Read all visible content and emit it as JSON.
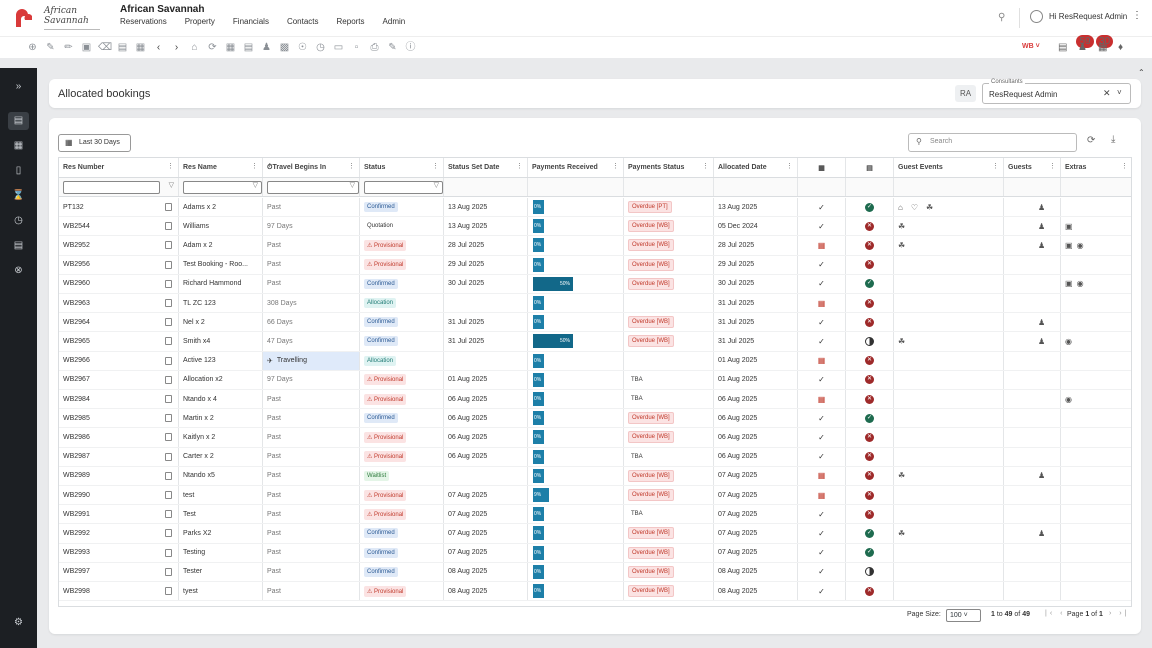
{
  "app": {
    "title": "African Savannah",
    "logo_text": "African Savannah"
  },
  "menu": [
    "Reservations",
    "Property",
    "Financials",
    "Contacts",
    "Reports",
    "Admin"
  ],
  "user": {
    "greeting": "Hi ResRequest Admin"
  },
  "toolbar": {
    "wb": "WB",
    "badge1": "59",
    "badge2": "30"
  },
  "page": {
    "title": "Allocated bookings",
    "initials": "RA",
    "consultants_label": "Consultants",
    "consultants_value": "ResRequest Admin"
  },
  "filters": {
    "date_range": "Last 30 Days",
    "search_placeholder": "Search"
  },
  "columns": [
    "Res Number",
    "Res Name",
    "Travel Begins In",
    "Status",
    "Status Set Date",
    "Payments Received",
    "Payments Status",
    "Allocated Date",
    "",
    "",
    "Guest Events",
    "Guests",
    "Extras"
  ],
  "rows": [
    {
      "res": "PT132",
      "name": "Adams x 2",
      "travel": "Past",
      "status": "Confirmed",
      "ssd": "13 Aug 2025",
      "pay": "0%",
      "ps": "Overdue [PT]",
      "alloc": "13 Aug 2025",
      "cal": "check",
      "bed": "green",
      "events": [
        "bed",
        "heart",
        "leaf"
      ],
      "guest": true,
      "extras": []
    },
    {
      "res": "WB2544",
      "name": "Williams",
      "travel": "97 Days",
      "status": "Quotation",
      "ssd": "13 Aug 2025",
      "pay": "0%",
      "ps": "Overdue [WB]",
      "alloc": "05 Dec 2024",
      "cal": "check",
      "bed": "red",
      "events": [
        "leaf"
      ],
      "guest": true,
      "extras": [
        "img"
      ]
    },
    {
      "res": "WB2952",
      "name": "Adam x 2",
      "travel": "Past",
      "status": "Provisional",
      "ssd": "28 Jul 2025",
      "pay": "0%",
      "ps": "Overdue [WB]",
      "alloc": "28 Jul 2025",
      "cal": "cal",
      "bed": "red",
      "events": [
        "leaf"
      ],
      "guest": true,
      "extras": [
        "img",
        "cam"
      ]
    },
    {
      "res": "WB2956",
      "name": "Test Booking - Roo...",
      "travel": "Past",
      "status": "Provisional",
      "ssd": "29 Jul 2025",
      "pay": "0%",
      "ps": "Overdue [WB]",
      "alloc": "29 Jul 2025",
      "cal": "check",
      "bed": "red",
      "events": [],
      "guest": false,
      "extras": []
    },
    {
      "res": "WB2960",
      "name": "Richard Hammond",
      "travel": "Past",
      "status": "Confirmed",
      "ssd": "30 Jul 2025",
      "pay": "50%",
      "ps": "Overdue [WB]",
      "alloc": "30 Jul 2025",
      "cal": "check",
      "bed": "green",
      "events": [],
      "guest": false,
      "extras": [
        "img",
        "cam"
      ]
    },
    {
      "res": "WB2963",
      "name": "TL ZC 123",
      "travel": "308 Days",
      "status": "Allocation",
      "ssd": "",
      "pay": "0%",
      "ps": "",
      "alloc": "31 Jul 2025",
      "cal": "cal",
      "bed": "red",
      "events": [],
      "guest": false,
      "extras": []
    },
    {
      "res": "WB2964",
      "name": "Nel x 2",
      "travel": "66 Days",
      "status": "Confirmed",
      "ssd": "31 Jul 2025",
      "pay": "0%",
      "ps": "Overdue [WB]",
      "alloc": "31 Jul 2025",
      "cal": "check",
      "bed": "red",
      "events": [],
      "guest": true,
      "extras": []
    },
    {
      "res": "WB2965",
      "name": "Smith x4",
      "travel": "47 Days",
      "status": "Confirmed",
      "ssd": "31 Jul 2025",
      "pay": "50%",
      "ps": "Overdue [WB]",
      "alloc": "31 Jul 2025",
      "cal": "check",
      "bed": "half",
      "events": [
        "leaf"
      ],
      "guest": true,
      "extras": [
        "cam"
      ]
    },
    {
      "res": "WB2966",
      "name": "Active 123",
      "travel": "Travelling",
      "status": "Allocation",
      "ssd": "",
      "pay": "0%",
      "ps": "",
      "alloc": "01 Aug 2025",
      "cal": "cal",
      "bed": "red",
      "events": [],
      "guest": false,
      "extras": []
    },
    {
      "res": "WB2967",
      "name": "Allocation x2",
      "travel": "97 Days",
      "status": "Provisional",
      "ssd": "01 Aug 2025",
      "pay": "0%",
      "ps": "TBA",
      "alloc": "01 Aug 2025",
      "cal": "check",
      "bed": "red",
      "events": [],
      "guest": false,
      "extras": []
    },
    {
      "res": "WB2984",
      "name": "Ntando x 4",
      "travel": "Past",
      "status": "Provisional",
      "ssd": "06 Aug 2025",
      "pay": "0%",
      "ps": "TBA",
      "alloc": "06 Aug 2025",
      "cal": "cal",
      "bed": "red",
      "events": [],
      "guest": false,
      "extras": [
        "cam"
      ]
    },
    {
      "res": "WB2985",
      "name": "Martin x 2",
      "travel": "Past",
      "status": "Confirmed",
      "ssd": "06 Aug 2025",
      "pay": "0%",
      "ps": "Overdue [WB]",
      "alloc": "06 Aug 2025",
      "cal": "check",
      "bed": "green",
      "events": [],
      "guest": false,
      "extras": []
    },
    {
      "res": "WB2986",
      "name": "Kaitlyn x 2",
      "travel": "Past",
      "status": "Provisional",
      "ssd": "06 Aug 2025",
      "pay": "0%",
      "ps": "Overdue [WB]",
      "alloc": "06 Aug 2025",
      "cal": "check",
      "bed": "red",
      "events": [],
      "guest": false,
      "extras": []
    },
    {
      "res": "WB2987",
      "name": "Carter x 2",
      "travel": "Past",
      "status": "Provisional",
      "ssd": "06 Aug 2025",
      "pay": "0%",
      "ps": "TBA",
      "alloc": "06 Aug 2025",
      "cal": "check",
      "bed": "red",
      "events": [],
      "guest": false,
      "extras": []
    },
    {
      "res": "WB2989",
      "name": "Ntando x5",
      "travel": "Past",
      "status": "Waitlist",
      "ssd": "",
      "pay": "0%",
      "ps": "Overdue [WB]",
      "alloc": "07 Aug 2025",
      "cal": "cal",
      "bed": "red",
      "events": [
        "leaf"
      ],
      "guest": true,
      "extras": []
    },
    {
      "res": "WB2990",
      "name": "test",
      "travel": "Past",
      "status": "Provisional",
      "ssd": "07 Aug 2025",
      "pay": "9%",
      "ps": "Overdue [WB]",
      "alloc": "07 Aug 2025",
      "cal": "cal",
      "bed": "red",
      "events": [],
      "guest": false,
      "extras": []
    },
    {
      "res": "WB2991",
      "name": "Test",
      "travel": "Past",
      "status": "Provisional",
      "ssd": "07 Aug 2025",
      "pay": "0%",
      "ps": "TBA",
      "alloc": "07 Aug 2025",
      "cal": "check",
      "bed": "red",
      "events": [],
      "guest": false,
      "extras": []
    },
    {
      "res": "WB2992",
      "name": "Parks X2",
      "travel": "Past",
      "status": "Confirmed",
      "ssd": "07 Aug 2025",
      "pay": "0%",
      "ps": "Overdue [WB]",
      "alloc": "07 Aug 2025",
      "cal": "check",
      "bed": "green",
      "events": [
        "leaf"
      ],
      "guest": true,
      "extras": []
    },
    {
      "res": "WB2993",
      "name": "Testing",
      "travel": "Past",
      "status": "Confirmed",
      "ssd": "07 Aug 2025",
      "pay": "0%",
      "ps": "Overdue [WB]",
      "alloc": "07 Aug 2025",
      "cal": "check",
      "bed": "green",
      "events": [],
      "guest": false,
      "extras": []
    },
    {
      "res": "WB2997",
      "name": "Tester",
      "travel": "Past",
      "status": "Confirmed",
      "ssd": "08 Aug 2025",
      "pay": "0%",
      "ps": "Overdue [WB]",
      "alloc": "08 Aug 2025",
      "cal": "check",
      "bed": "half",
      "events": [],
      "guest": false,
      "extras": []
    },
    {
      "res": "WB2998",
      "name": "tyest",
      "travel": "Past",
      "status": "Provisional",
      "ssd": "08 Aug 2025",
      "pay": "0%",
      "ps": "Overdue [WB]",
      "alloc": "08 Aug 2025",
      "cal": "check",
      "bed": "red",
      "events": [],
      "guest": false,
      "extras": []
    }
  ],
  "pagination": {
    "page_size_label": "Page Size:",
    "page_size": "100",
    "range_start": "1",
    "range_end": "49",
    "total": "49",
    "page_label": "Page",
    "page": "1",
    "of": "of",
    "pages": "1",
    "to": "to"
  }
}
